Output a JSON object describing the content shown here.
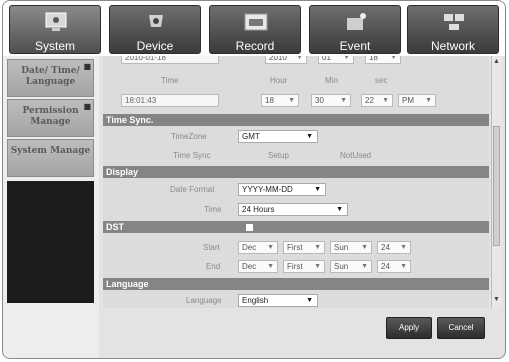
{
  "tabs": [
    {
      "label": "System",
      "icon": "monitor-icon"
    },
    {
      "label": "Device",
      "icon": "camera-icon"
    },
    {
      "label": "Record",
      "icon": "rec-icon"
    },
    {
      "label": "Event",
      "icon": "alarm-icon"
    },
    {
      "label": "Network",
      "icon": "network-icon"
    }
  ],
  "sidebar": {
    "items": [
      {
        "label": "Date/ Time/ Language"
      },
      {
        "label": "Permission Manage"
      },
      {
        "label": "System Manage"
      }
    ]
  },
  "date_row": {
    "value": "2010-01-18",
    "year": "2010",
    "month": "01",
    "day": "18"
  },
  "time": {
    "label": "Time",
    "hour_label": "Hour",
    "min_label": "Min",
    "sec_label": "sec",
    "current": "18:01:43",
    "hour": "18",
    "min": "30",
    "sec": "22",
    "ampm": "PM"
  },
  "time_sync": {
    "title": "Time Sync.",
    "timezone_label": "TimeZone",
    "timezone": "GMT",
    "sync_label": "Time Sync",
    "setup_label": "Setup",
    "status": "NotUsed"
  },
  "display": {
    "title": "Display",
    "date_format_label": "Date Format",
    "date_format": "YYYY-MM-DD",
    "time_label": "Time",
    "time_format": "24 Hours"
  },
  "dst": {
    "title": "DST",
    "start_label": "Start",
    "end_label": "End",
    "start": {
      "month": "Dec",
      "week": "First",
      "day": "Sun",
      "hour": "24"
    },
    "end": {
      "month": "Dec",
      "week": "First",
      "day": "Sun",
      "hour": "24"
    }
  },
  "language": {
    "title": "Language",
    "label": "Language",
    "value": "English"
  },
  "buttons": {
    "apply": "Apply",
    "cancel": "Cancel"
  }
}
